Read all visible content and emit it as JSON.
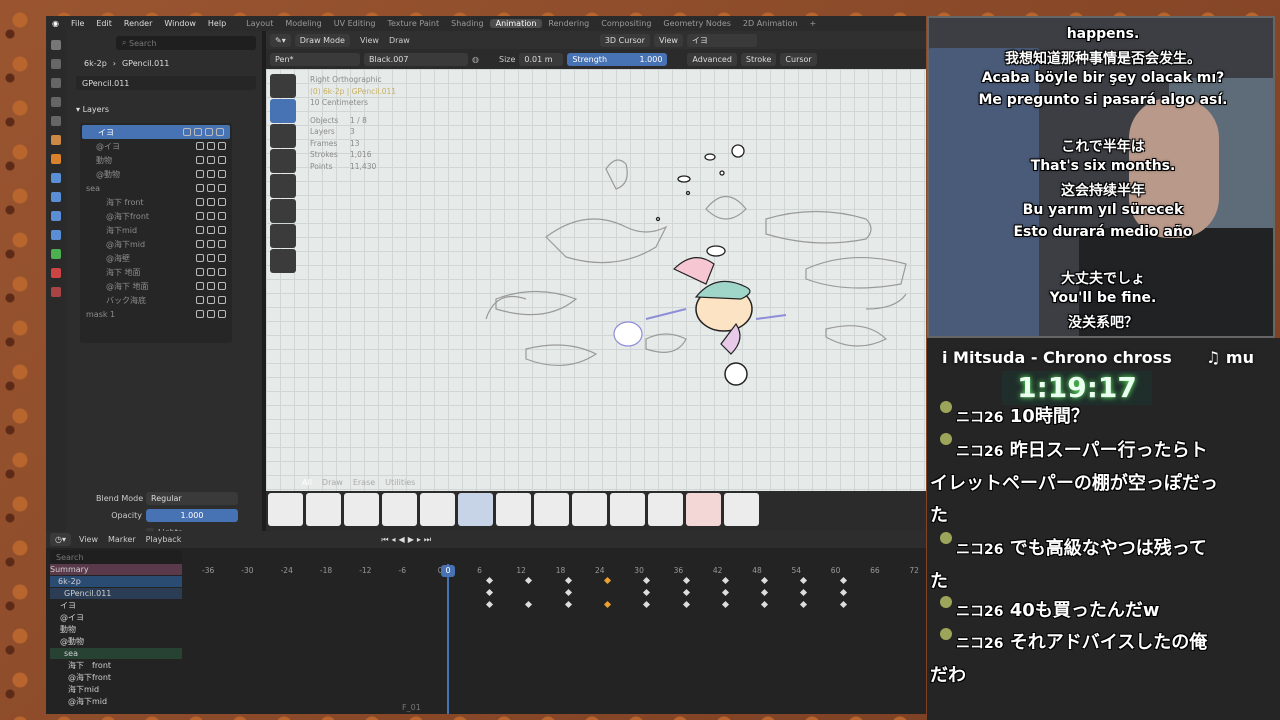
{
  "menus": [
    "File",
    "Edit",
    "Render",
    "Window",
    "Help"
  ],
  "workspaces": [
    "Layout",
    "Modeling",
    "UV Editing",
    "Texture Paint",
    "Shading",
    "Animation",
    "Rendering",
    "Compositing",
    "Geometry Nodes",
    "2D Animation"
  ],
  "active_workspace": "Animation",
  "props": {
    "search_placeholder": "Search",
    "object_name": "6k-2p",
    "data_name": "GPencil.011",
    "gp_data": "GPencil.011",
    "layers_header": "Layers",
    "layers": [
      "イヨ",
      "@イヨ",
      "動物",
      "@動物",
      "sea",
      "海下 front",
      "@海下front",
      "海下mid",
      "@海下mid",
      "@海壁",
      "海下 地面",
      "@海下 地面",
      "バック海底",
      "mask 1"
    ],
    "blend_mode_label": "Blend Mode",
    "blend_mode": "Regular",
    "opacity_label": "Opacity",
    "opacity": "1.000",
    "lights_label": "Lights"
  },
  "viewport": {
    "mode": "Draw Mode",
    "view": "View",
    "draw": "Draw",
    "cursor": "3D Cursor",
    "view_dd": "View",
    "layer_dd": "イヨ",
    "brush": "Pen*",
    "material": "Black.007",
    "size_label": "Size",
    "size": "0.01 m",
    "strength_label": "Strength",
    "strength": "1.000",
    "advanced": "Advanced",
    "stroke": "Stroke",
    "cursor_menu": "Cursor",
    "stats": {
      "view_name": "Right Orthographic",
      "context": "(0) 6k-2p | GPencil.011",
      "scale": "10 Centimeters",
      "objects_label": "Objects",
      "objects": "1 / 8",
      "layers_label": "Layers",
      "layers": "3",
      "frames_label": "Frames",
      "frames": "13",
      "strokes_label": "Strokes",
      "strokes": "1,016",
      "points_label": "Points",
      "points": "11,430"
    }
  },
  "brush_tabs": [
    "All",
    "Draw",
    "Erase",
    "Utilities"
  ],
  "timeline": {
    "view": "View",
    "marker": "Marker",
    "playback": "Playback",
    "search_placeholder": "Search",
    "ruler": [
      "-36",
      "-30",
      "-24",
      "-18",
      "-12",
      "-6",
      "0",
      "6",
      "12",
      "18",
      "24",
      "30",
      "36",
      "42",
      "48",
      "54",
      "60",
      "66",
      "72"
    ],
    "current_frame": "0",
    "channels": [
      "Summary",
      "6k-2p",
      "GPencil.011",
      "イヨ",
      "@イヨ",
      "動物",
      "@動物",
      "sea",
      "海下　front",
      "@海下front",
      "海下mid",
      "@海下mid"
    ],
    "footer": "F_01"
  },
  "stream": {
    "subs": [
      "happens.",
      "我想知道那种事情是否会发生。",
      "Acaba böyle bir şey olacak mı?",
      "Me pregunto si pasará algo así.",
      "これで半年は",
      "That's six months.",
      "这会持续半年",
      "Bu yarım yıl sürecek",
      "Esto durará medio año",
      "大丈夫でしょ",
      "You'll be fine.",
      "没关系吧？"
    ],
    "music": "i Mitsuda - Chrono chross",
    "music_icon": "♫ mu",
    "timer": "1:19:17",
    "chat": [
      {
        "name": "ニコ26",
        "text": "10時間？"
      },
      {
        "name": "ニコ26",
        "text": "昨日スーパー行ったらトイレットペーパーの棚が空っぽだった"
      },
      {
        "name": "ニコ26",
        "text": "でも高級なやつは残ってた"
      },
      {
        "name": "ニコ26",
        "text": "40も買ったんだw"
      },
      {
        "name": "ニコ26",
        "text": "それアドバイスしたの俺だわ"
      }
    ]
  }
}
